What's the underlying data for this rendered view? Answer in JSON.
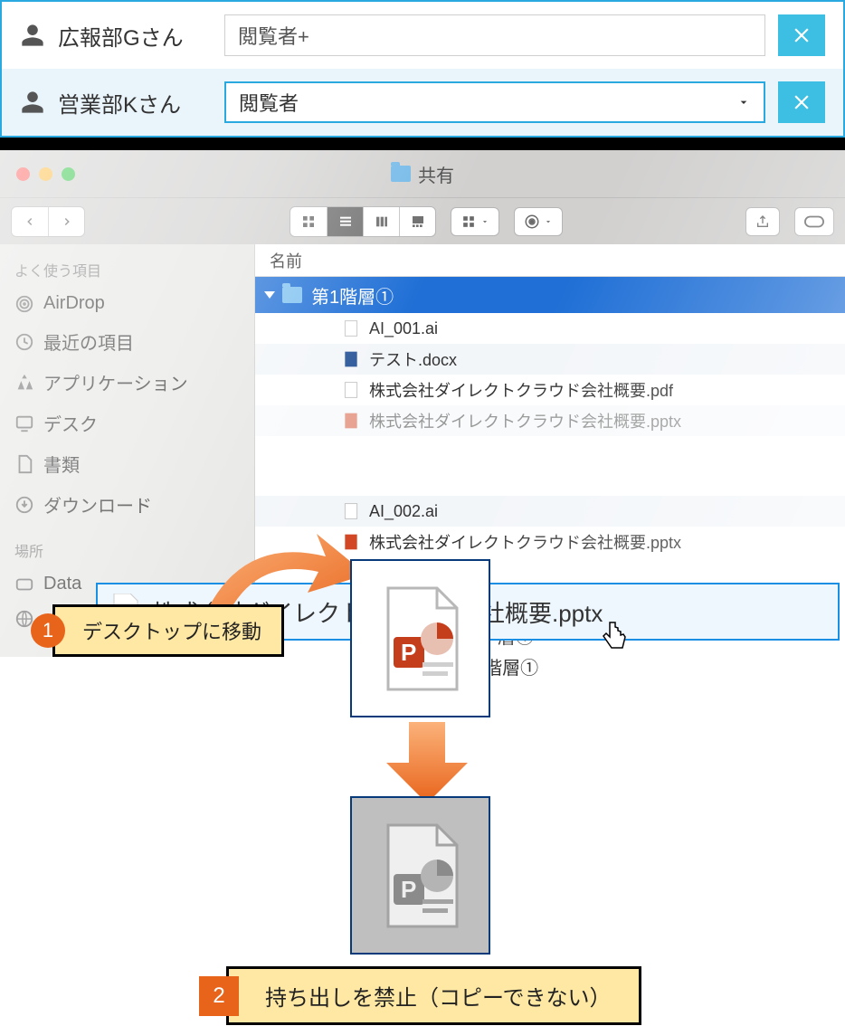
{
  "perm": {
    "rows": [
      {
        "name": "広報部Gさん",
        "role": "閲覧者+"
      },
      {
        "name": "営業部Kさん",
        "role": "閲覧者"
      }
    ]
  },
  "finder": {
    "title": "共有",
    "sidebar": {
      "favorites_head": "よく使う項目",
      "items": [
        "AirDrop",
        "最近の項目",
        "アプリケーション",
        "デスク",
        "書類",
        "ダウンロード"
      ],
      "locations_head": "場所",
      "locations": [
        "Data"
      ]
    },
    "list": {
      "header": "名前",
      "folder": "第1階層①",
      "files": [
        "AI_001.ai",
        "テスト.docx",
        "株式会社ダイレクトクラウド会社概要.pdf",
        "株式会社ダイレクトクラウド会社概要.pptx",
        "AI_002.ai",
        "株式会社ダイレクトクラウド会社概要.pptx"
      ],
      "remnants": [
        "層①",
        "6階層①"
      ]
    }
  },
  "drag_tip": "株式会社ダイレクトクラウド会社概要.pptx",
  "callouts": [
    {
      "num": "1",
      "text": "デスクトップに移動"
    },
    {
      "num": "2",
      "text": "持ち出しを禁止（コピーできない）"
    }
  ]
}
